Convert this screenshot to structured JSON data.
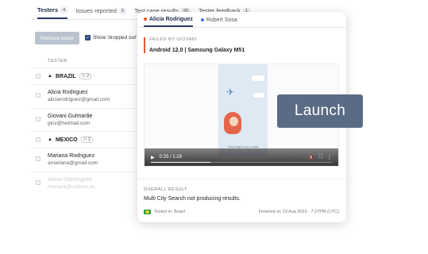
{
  "tabs": [
    {
      "label": "Testers",
      "count": "4"
    },
    {
      "label": "Issues reported",
      "count": "0"
    },
    {
      "label": "Test case results",
      "count": "20"
    },
    {
      "label": "Tester feedback",
      "count": "1"
    }
  ],
  "toolbar": {
    "remove_label": "Remove tester",
    "show_dropped_label": "Show 'dropped out'"
  },
  "table": {
    "column_header": "TESTER",
    "groups": [
      {
        "name": "BRAZIL",
        "count": "2",
        "testers": [
          {
            "name": "Alicia Rodriguez",
            "email": "aliciarodriguez@gmail.com"
          },
          {
            "name": "Giovani Gulmarãe",
            "email": "gicv@hetmail.com"
          }
        ]
      },
      {
        "name": "MEXICO",
        "count": "2",
        "testers": [
          {
            "name": "Mariana Rodriguez",
            "email": "amariana@gmail.com"
          },
          {
            "name": "Alison Dominguez",
            "email": "mariana@outlook.es"
          }
        ]
      }
    ]
  },
  "card": {
    "tabs": [
      {
        "label": "Alicia Rodriguez",
        "dot_color": "#e05a2b"
      },
      {
        "label": "Robert Sosa",
        "dot_color": "#3c7be0"
      }
    ],
    "failed_by": "FAILED BY GIOVANI",
    "device": "Android 12.0 | Samsung Galaxy M51",
    "video": {
      "time": "0:25 / 1:28",
      "progress": 0.33,
      "caption": "Choose flight to see 1+ deals"
    },
    "overall_label": "OVERALL RESULT",
    "overall_text": "Multi City Search not producing results.",
    "tested_in": "Tested in: Brazil",
    "finished": "Finished on 23 Aug 2023 - 7:27PM (UTC)"
  },
  "overlay": {
    "launch_label": "Launch"
  },
  "colors": {
    "accent": "#2c3e5c",
    "failed": "#e05a2b",
    "launch_bg": "#5a6c85"
  }
}
